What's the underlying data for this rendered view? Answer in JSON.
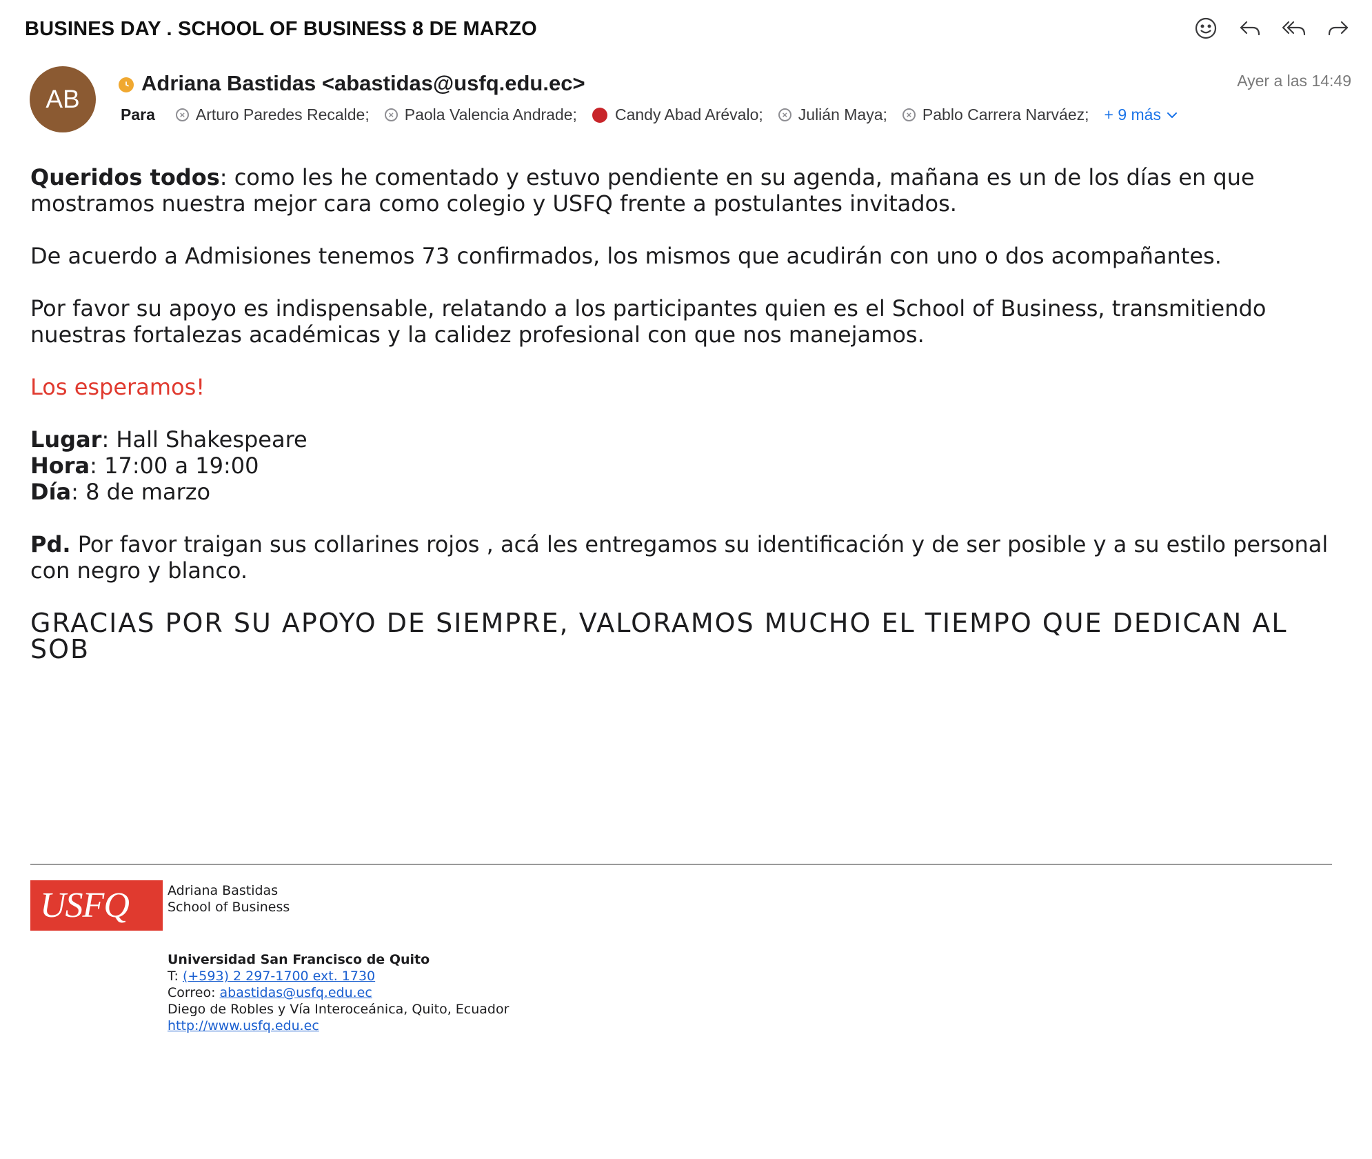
{
  "subject": "BUSINES DAY . SCHOOL OF BUSINESS 8 DE MARZO",
  "avatar_initials": "AB",
  "sender": "Adriana Bastidas <abastidas@usfq.edu.ec>",
  "timestamp": "Ayer a las 14:49",
  "to_label": "Para",
  "recipients": [
    "Arturo Paredes Recalde;",
    "Paola Valencia Andrade;",
    "Candy Abad Arévalo;",
    "Julián Maya;",
    "Pablo Carrera Narváez;"
  ],
  "more_recipients": "+ 9 más",
  "body": {
    "p1_bold": "Queridos todos",
    "p1_text": ": como les he comentado y estuvo pendiente en su agenda, mañana es un de los días en que mostramos nuestra mejor cara como colegio y USFQ frente a postulantes invitados.",
    "p2": "De acuerdo a Admisiones tenemos 73 confirmados, los mismos que acudirán con uno o dos acompañantes.",
    "p3": "Por favor su apoyo es indispensable, relatando a los participantes quien es el School of Business, transmitiendo nuestras fortalezas académicas y la calidez profesional con que nos manejamos.",
    "p4": "Los esperamos!",
    "lugar_label": "Lugar",
    "lugar_value": ": Hall Shakespeare",
    "hora_label": "Hora",
    "hora_value": ": 17:00 a 19:00",
    "dia_label": "Día",
    "dia_value": ": 8 de marzo",
    "pd_label": "Pd.",
    "pd_text": " Por favor traigan sus collarines rojos , acá les entregamos su identificación y de ser posible y a su estilo personal con negro y blanco.",
    "closing": "GRACIAS POR SU APOYO DE SIEMPRE, VALORAMOS MUCHO EL TIEMPO QUE DEDICAN AL SOB"
  },
  "signature": {
    "logo_text": "USFQ",
    "name": "Adriana Bastidas",
    "dept": "School of Business",
    "org": "Universidad San Francisco de Quito",
    "phone_label": "T: ",
    "phone": "(+593) 2 297-1700 ext. 1730",
    "email_label": "Correo: ",
    "email": "abastidas@usfq.edu.ec",
    "address": "Diego de Robles y Vía Interoceánica, Quito, Ecuador",
    "website": "http://www.usfq.edu.ec"
  },
  "colors": {
    "avatar": "#8b5a32",
    "status_dot": "#f0a830",
    "highlight_red": "#e03a2f",
    "link_blue": "#1a73e8"
  },
  "icons": [
    "emoji-icon",
    "reply-icon",
    "reply-all-icon",
    "forward-icon"
  ]
}
